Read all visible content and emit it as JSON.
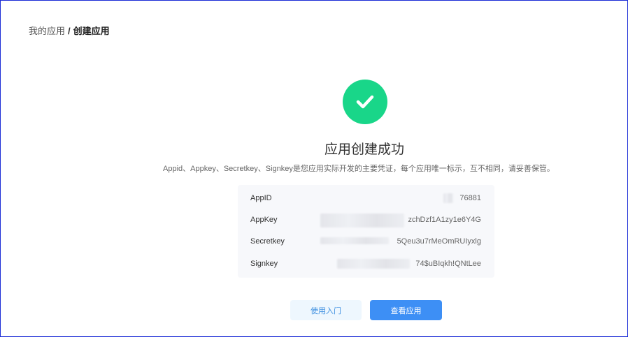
{
  "breadcrumb": {
    "parent": "我的应用",
    "separator": "/",
    "current": "创建应用"
  },
  "result": {
    "icon": "check-circle-icon",
    "icon_color": "#19d689",
    "title": "应用创建成功",
    "description": "Appid、Appkey、Secretkey、Signkey是您应用实际开发的主要凭证，每个应用唯一标示，互不相同，请妥善保管。"
  },
  "credentials": [
    {
      "label": "AppID",
      "value": "76881"
    },
    {
      "label": "AppKey",
      "value": "zchDzf1A1zy1e6Y4G"
    },
    {
      "label": "Secretkey",
      "value": "5Qeu3u7rMeOmRUIyxlg"
    },
    {
      "label": "Signkey",
      "value": "74$uBIqkh!QNtLee"
    }
  ],
  "actions": {
    "secondary_label": "使用入门",
    "primary_label": "查看应用",
    "primary_color": "#3d8ff5"
  }
}
